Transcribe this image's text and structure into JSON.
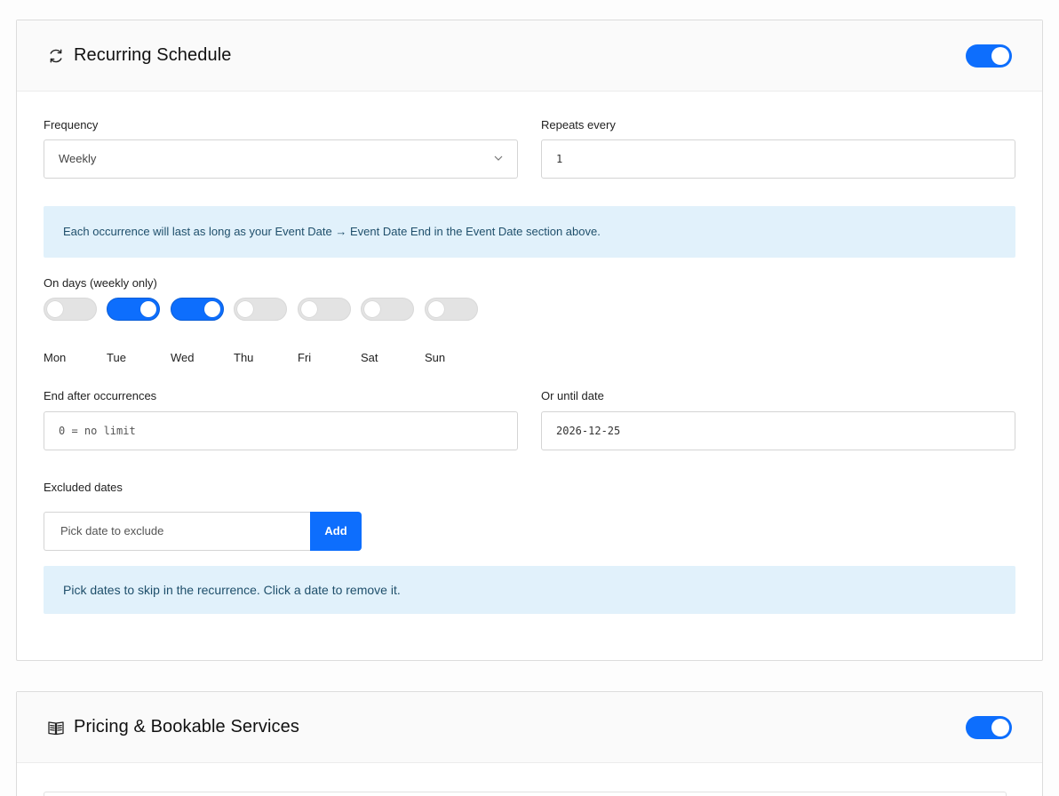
{
  "recurring": {
    "title": "Recurring Schedule",
    "icon": "refresh-icon",
    "enabled": true,
    "frequency": {
      "label": "Frequency",
      "value": "Weekly"
    },
    "repeats": {
      "label": "Repeats every",
      "value": "1"
    },
    "duration_note": "Each occurrence will last as long as your Event Date → Event Date End in the Event Date section above.",
    "days": {
      "label": "On days (weekly only)",
      "items": [
        {
          "name": "Mon",
          "on": false
        },
        {
          "name": "Tue",
          "on": true
        },
        {
          "name": "Wed",
          "on": true
        },
        {
          "name": "Thu",
          "on": false
        },
        {
          "name": "Fri",
          "on": false
        },
        {
          "name": "Sat",
          "on": false
        },
        {
          "name": "Sun",
          "on": false
        }
      ]
    },
    "end_after": {
      "label": "End after occurrences",
      "placeholder": "0 = no limit"
    },
    "until": {
      "label": "Or until date",
      "value": "2026-12-25"
    },
    "excluded": {
      "label": "Excluded dates",
      "placeholder": "Pick date to exclude",
      "add_label": "Add",
      "note": "Pick dates to skip in the recurrence. Click a date to remove it."
    }
  },
  "pricing": {
    "title": "Pricing & Bookable Services",
    "icon": "book-icon",
    "enabled": true
  },
  "colors": {
    "accent": "#0d6efd",
    "info_bg": "#e1f1fb",
    "info_text": "#1f4f6b",
    "toggle_off": "#e3e3e3"
  }
}
